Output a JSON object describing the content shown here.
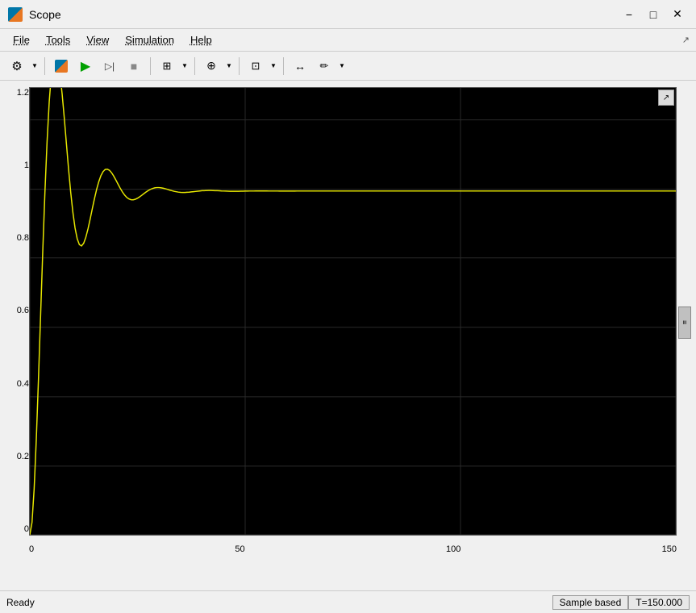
{
  "window": {
    "title": "Scope",
    "icon": "scope-icon"
  },
  "titlebar": {
    "minimize_label": "−",
    "maximize_label": "□",
    "close_label": "✕"
  },
  "menubar": {
    "items": [
      {
        "label": "File",
        "id": "file"
      },
      {
        "label": "Tools",
        "id": "tools"
      },
      {
        "label": "View",
        "id": "view"
      },
      {
        "label": "Simulation",
        "id": "simulation"
      },
      {
        "label": "Help",
        "id": "help"
      }
    ]
  },
  "toolbar": {
    "groups": [
      {
        "buttons": [
          {
            "icon": "⚙",
            "name": "settings-btn",
            "label": "Settings"
          }
        ]
      },
      {
        "buttons": [
          {
            "icon": "◉",
            "name": "simulink-btn",
            "label": "Simulink"
          },
          {
            "icon": "▶",
            "name": "play-btn",
            "label": "Run",
            "color": "#00a000"
          },
          {
            "icon": "▷|",
            "name": "step-btn",
            "label": "Step"
          },
          {
            "icon": "■",
            "name": "stop-btn",
            "label": "Stop"
          }
        ]
      },
      {
        "buttons": [
          {
            "icon": "⊞",
            "name": "layout-btn",
            "label": "Layout"
          }
        ]
      },
      {
        "buttons": [
          {
            "icon": "⊕",
            "name": "zoom-btn",
            "label": "Zoom"
          }
        ]
      },
      {
        "buttons": [
          {
            "icon": "⊡",
            "name": "axes-btn",
            "label": "Axes"
          }
        ]
      },
      {
        "buttons": [
          {
            "icon": "↔",
            "name": "cursor-btn",
            "label": "Cursor"
          },
          {
            "icon": "✏",
            "name": "annotate-btn",
            "label": "Annotate"
          }
        ]
      }
    ]
  },
  "plot": {
    "background": "#000000",
    "curve_color": "#e8e800",
    "y_axis": {
      "labels": [
        "0",
        "0.2",
        "0.4",
        "0.6",
        "0.8",
        "1",
        "1.2"
      ],
      "min": 0,
      "max": 1.3
    },
    "x_axis": {
      "labels": [
        "0",
        "50",
        "100",
        "150"
      ],
      "min": 0,
      "max": 150
    },
    "grid": {
      "vertical_lines": [
        0,
        50,
        100,
        150
      ],
      "horizontal_lines": [
        0,
        0.2,
        0.4,
        0.6,
        0.8,
        1.0,
        1.2
      ]
    }
  },
  "statusbar": {
    "status": "Ready",
    "sample_type": "Sample based",
    "time": "T=150.000"
  }
}
